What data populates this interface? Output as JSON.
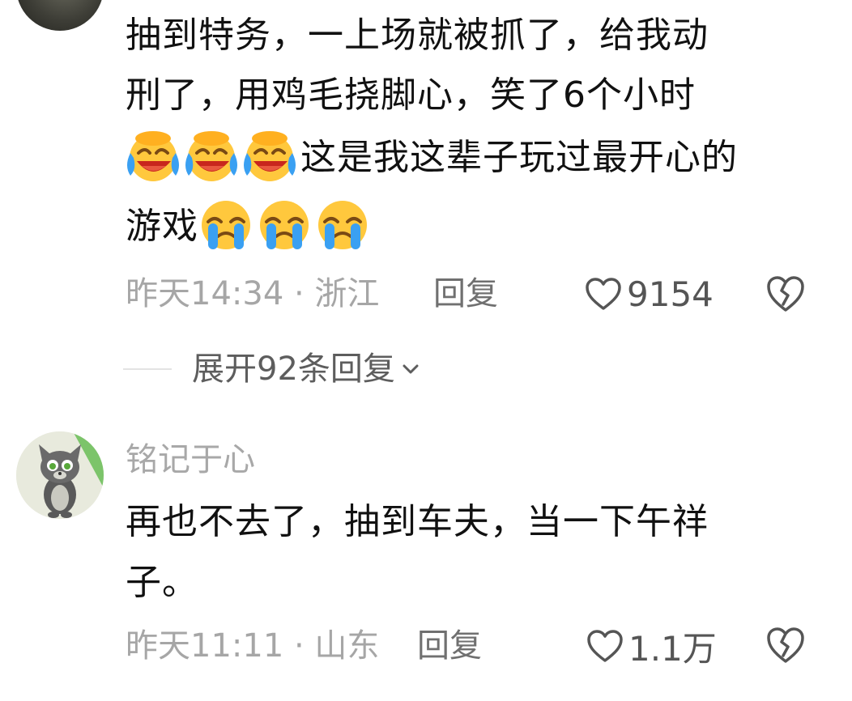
{
  "comments": [
    {
      "text_line1": "抽到特务，一上场就被抓了，给我动",
      "text_line2": "刑了，用鸡毛挠脚心，笑了6个小时",
      "text_line3": "这是我这辈子玩过最开心的",
      "text_line4": "游戏",
      "emojis_line3": [
        "laughing-crying-emoji",
        "laughing-crying-emoji",
        "laughing-crying-emoji"
      ],
      "emojis_line4": [
        "crying-emoji",
        "crying-emoji",
        "crying-emoji"
      ],
      "meta": "昨天14:34 · 浙江",
      "reply_label": "回复",
      "likes": "9154",
      "expand_replies": "展开92条回复"
    },
    {
      "username": "铭记于心",
      "text_line1": "再也不去了，抽到车夫，当一下午祥",
      "text_line2": "子。",
      "meta": "昨天11:11 · 山东",
      "reply_label": "回复",
      "likes": "1.1万"
    }
  ],
  "icons": {
    "like": "heart-outline-icon",
    "dislike": "broken-heart-icon",
    "expand": "chevron-down-icon"
  },
  "colors": {
    "text": "#111111",
    "meta": "#a6a6a6",
    "reply": "#707070",
    "emoji_yellow": "#ffc83d",
    "emoji_tear_blue": "#3aa0f2"
  }
}
